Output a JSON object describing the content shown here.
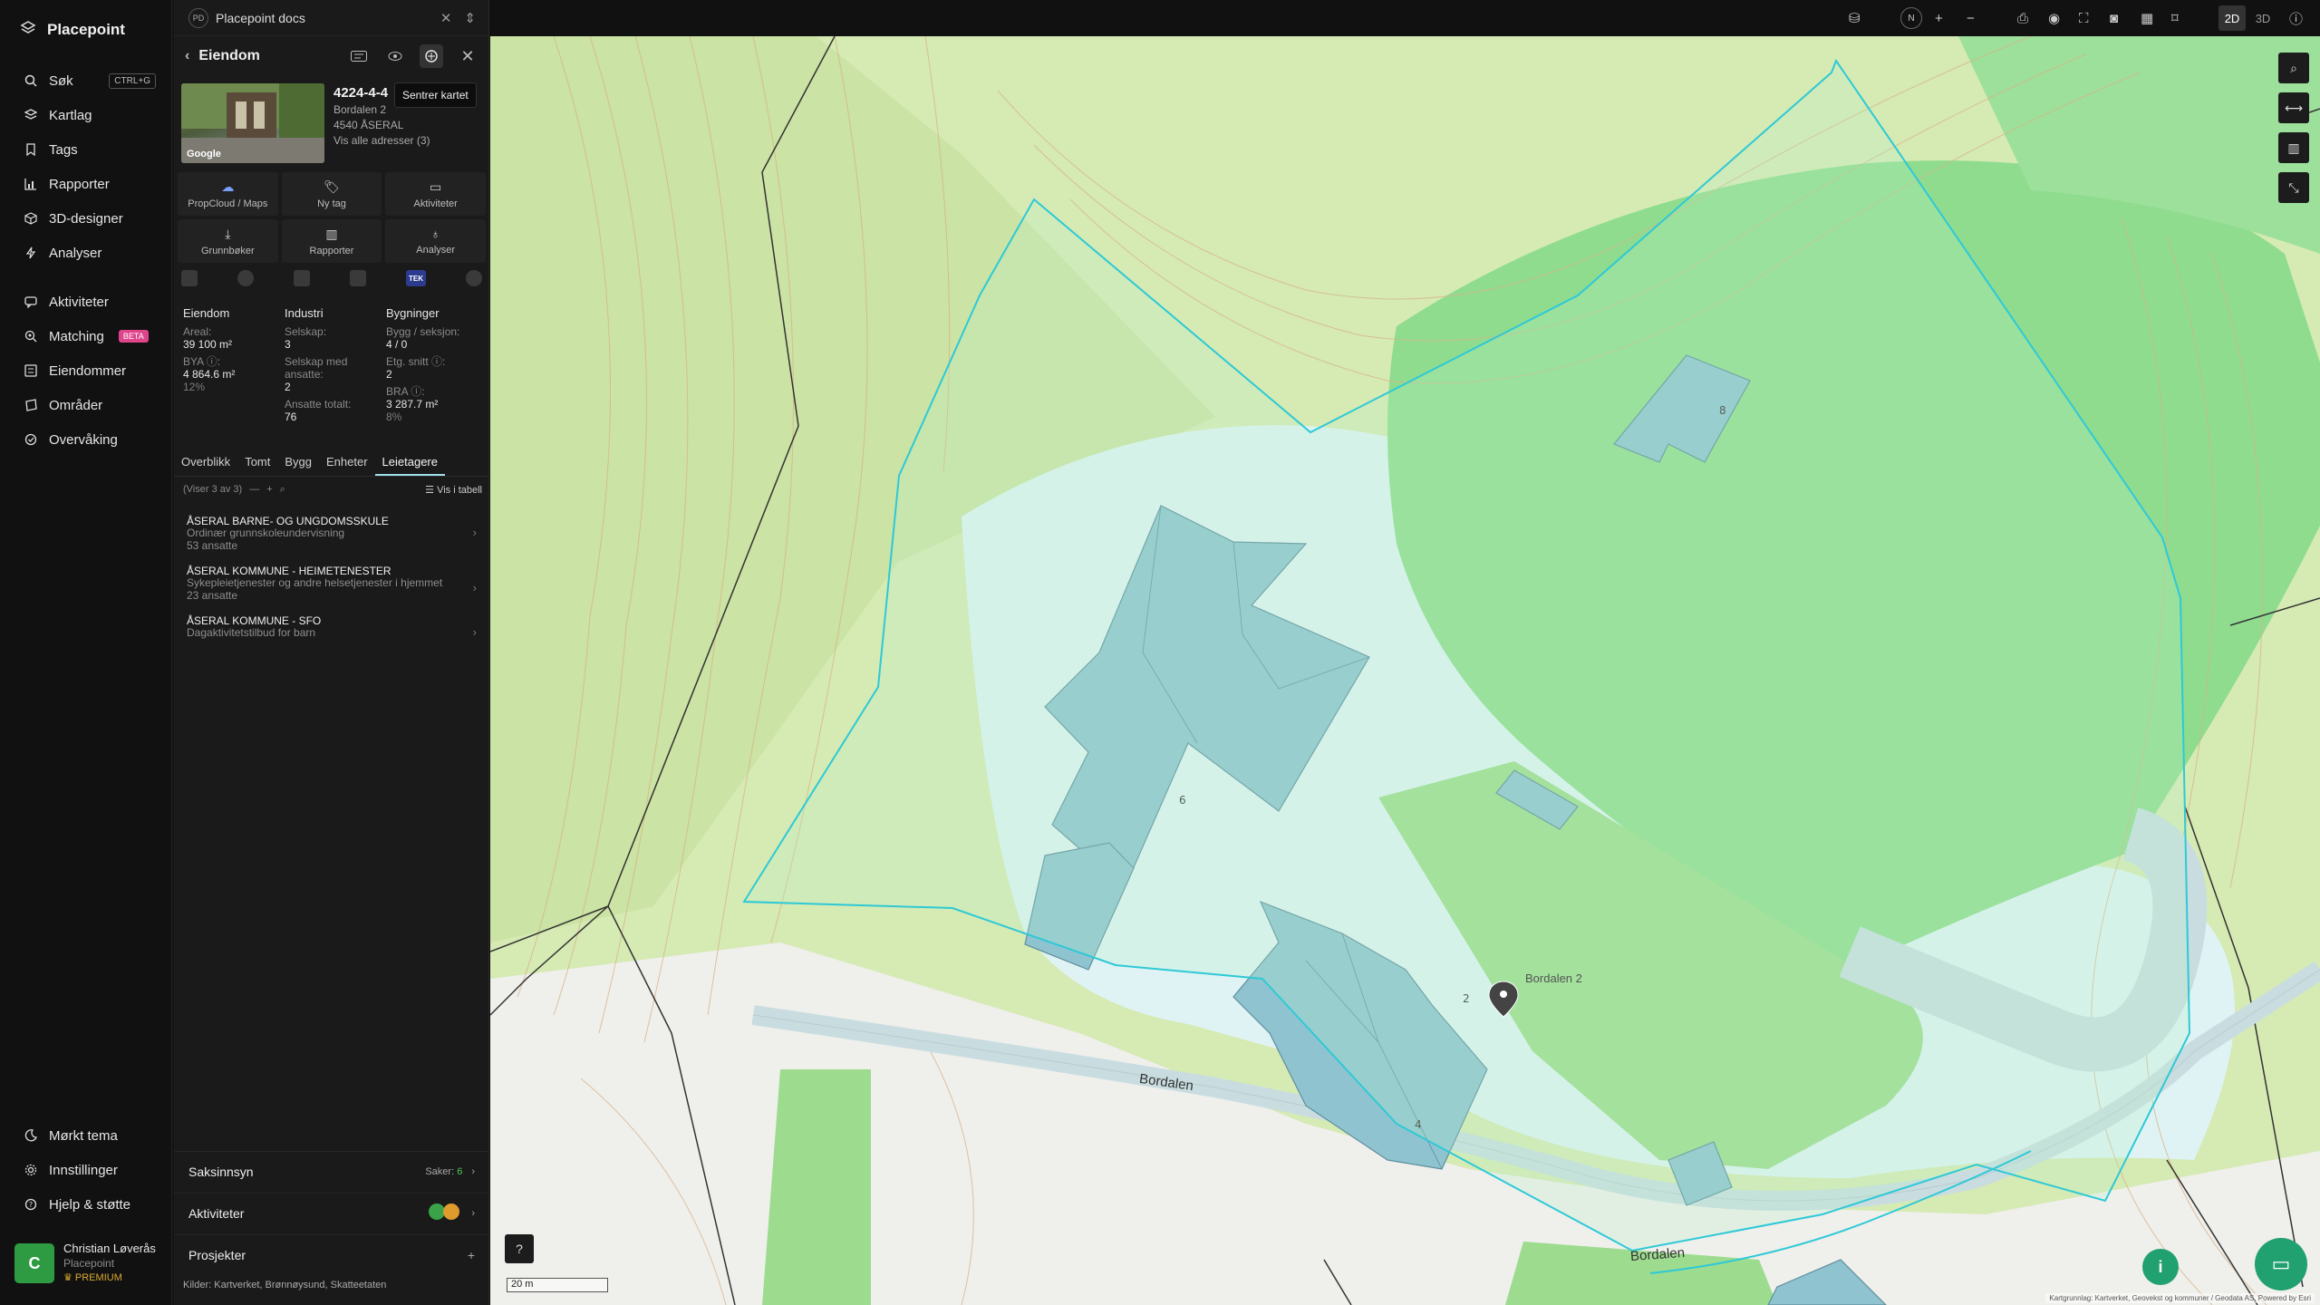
{
  "brand": {
    "name": "Placepoint"
  },
  "nav": {
    "top": [
      {
        "label": "Søk",
        "icon": "search-icon",
        "kbd": "CTRL+G"
      },
      {
        "label": "Kartlag",
        "icon": "layers-icon"
      },
      {
        "label": "Tags",
        "icon": "bookmark-icon"
      },
      {
        "label": "Rapporter",
        "icon": "chart-icon"
      },
      {
        "label": "3D-designer",
        "icon": "cube-icon"
      },
      {
        "label": "Analyser",
        "icon": "lightning-icon"
      }
    ],
    "mid": [
      {
        "label": "Aktiviteter",
        "icon": "chat-icon"
      },
      {
        "label": "Matching",
        "icon": "match-icon",
        "badge": "BETA"
      },
      {
        "label": "Eiendommer",
        "icon": "list-icon"
      },
      {
        "label": "Områder",
        "icon": "area-icon"
      },
      {
        "label": "Overvåking",
        "icon": "monitor-icon"
      }
    ],
    "bottom": [
      {
        "label": "Mørkt tema",
        "icon": "moon-icon"
      },
      {
        "label": "Innstillinger",
        "icon": "gear-icon"
      },
      {
        "label": "Hjelp & støtte",
        "icon": "help-icon"
      }
    ]
  },
  "user": {
    "initial": "C",
    "name": "Christian Løverås",
    "org": "Placepoint",
    "plan": "PREMIUM"
  },
  "doc_tab": {
    "badge": "PD",
    "title": "Placepoint docs"
  },
  "panel": {
    "title": "Eiendom",
    "tooltip": "Sentrer kartet",
    "property": {
      "id": "4224-4-4",
      "address": "Bordalen 2",
      "postal": "4540 ÅSERAL",
      "all_addresses": "Vis alle adresser (3)",
      "photo_credit": "Google"
    },
    "actions": [
      {
        "label": "PropCloud / Maps",
        "icon": "cloud-icon"
      },
      {
        "label": "Ny tag",
        "icon": "bookmark-icon"
      },
      {
        "label": "Aktiviteter",
        "icon": "chat-icon"
      },
      {
        "label": "Grunnbøker",
        "icon": "download-icon"
      },
      {
        "label": "Rapporter",
        "icon": "chart-icon"
      },
      {
        "label": "Analyser",
        "icon": "bulb-icon"
      }
    ],
    "tek_label": "TEK",
    "stats": {
      "eiendom": {
        "heading": "Eiendom",
        "areal_label": "Areal:",
        "areal": "39 100 m²",
        "bya_label": "BYA ⓘ:",
        "bya": "4 864.6 m²",
        "bya_pct": "12%"
      },
      "industri": {
        "heading": "Industri",
        "selskap_label": "Selskap:",
        "selskap": "3",
        "selskap_ans_label": "Selskap med ansatte:",
        "selskap_ans": "2",
        "ansatte_label": "Ansatte totalt:",
        "ansatte": "76"
      },
      "bygninger": {
        "heading": "Bygninger",
        "bygg_label": "Bygg / seksjon:",
        "bygg": "4 / 0",
        "etg_label": "Etg. snitt ⓘ:",
        "etg": "2",
        "bra_label": "BRA ⓘ:",
        "bra": "3 287.7 m²",
        "bra_pct": "8%"
      }
    },
    "tabs": [
      "Overblikk",
      "Tomt",
      "Bygg",
      "Enheter",
      "Leietagere"
    ],
    "active_tab": "Leietagere",
    "subbar": {
      "count": "(Viser 3 av 3)",
      "table": "Vis i tabell"
    },
    "tenants": [
      {
        "name": "ÅSERAL BARNE- OG UNGDOMSSKULE",
        "desc": "Ordinær grunnskoleundervisning",
        "count": "53 ansatte"
      },
      {
        "name": "ÅSERAL KOMMUNE - HEIMETENESTER",
        "desc": "Sykepleietjenester og andre helsetjenester i hjemmet",
        "count": "23 ansatte"
      },
      {
        "name": "ÅSERAL KOMMUNE - SFO",
        "desc": "Dagaktivitetstilbud for barn",
        "count": ""
      }
    ],
    "sections": {
      "saksinnsyn": {
        "label": "Saksinnsyn",
        "meta": "Saker:",
        "count": "6"
      },
      "aktiviteter": {
        "label": "Aktiviteter"
      },
      "prosjekter": {
        "label": "Prosjekter"
      }
    },
    "sources": {
      "label": "Kilder:",
      "items": "Kartverket, Brønnøysund, Skatteetaten"
    }
  },
  "toolbar": {
    "north": "N",
    "mode_2d": "2D",
    "mode_3d": "3D"
  },
  "map": {
    "road_label": "Bordalen",
    "marker_label": "Bordalen 2",
    "scale": "20 m",
    "attribution": "Kartgrunnlag: Kartverket, Geovekst og kommuner / Geodata AS, Powered by Esri",
    "building_numbers": [
      "6",
      "4",
      "2",
      "8"
    ]
  }
}
